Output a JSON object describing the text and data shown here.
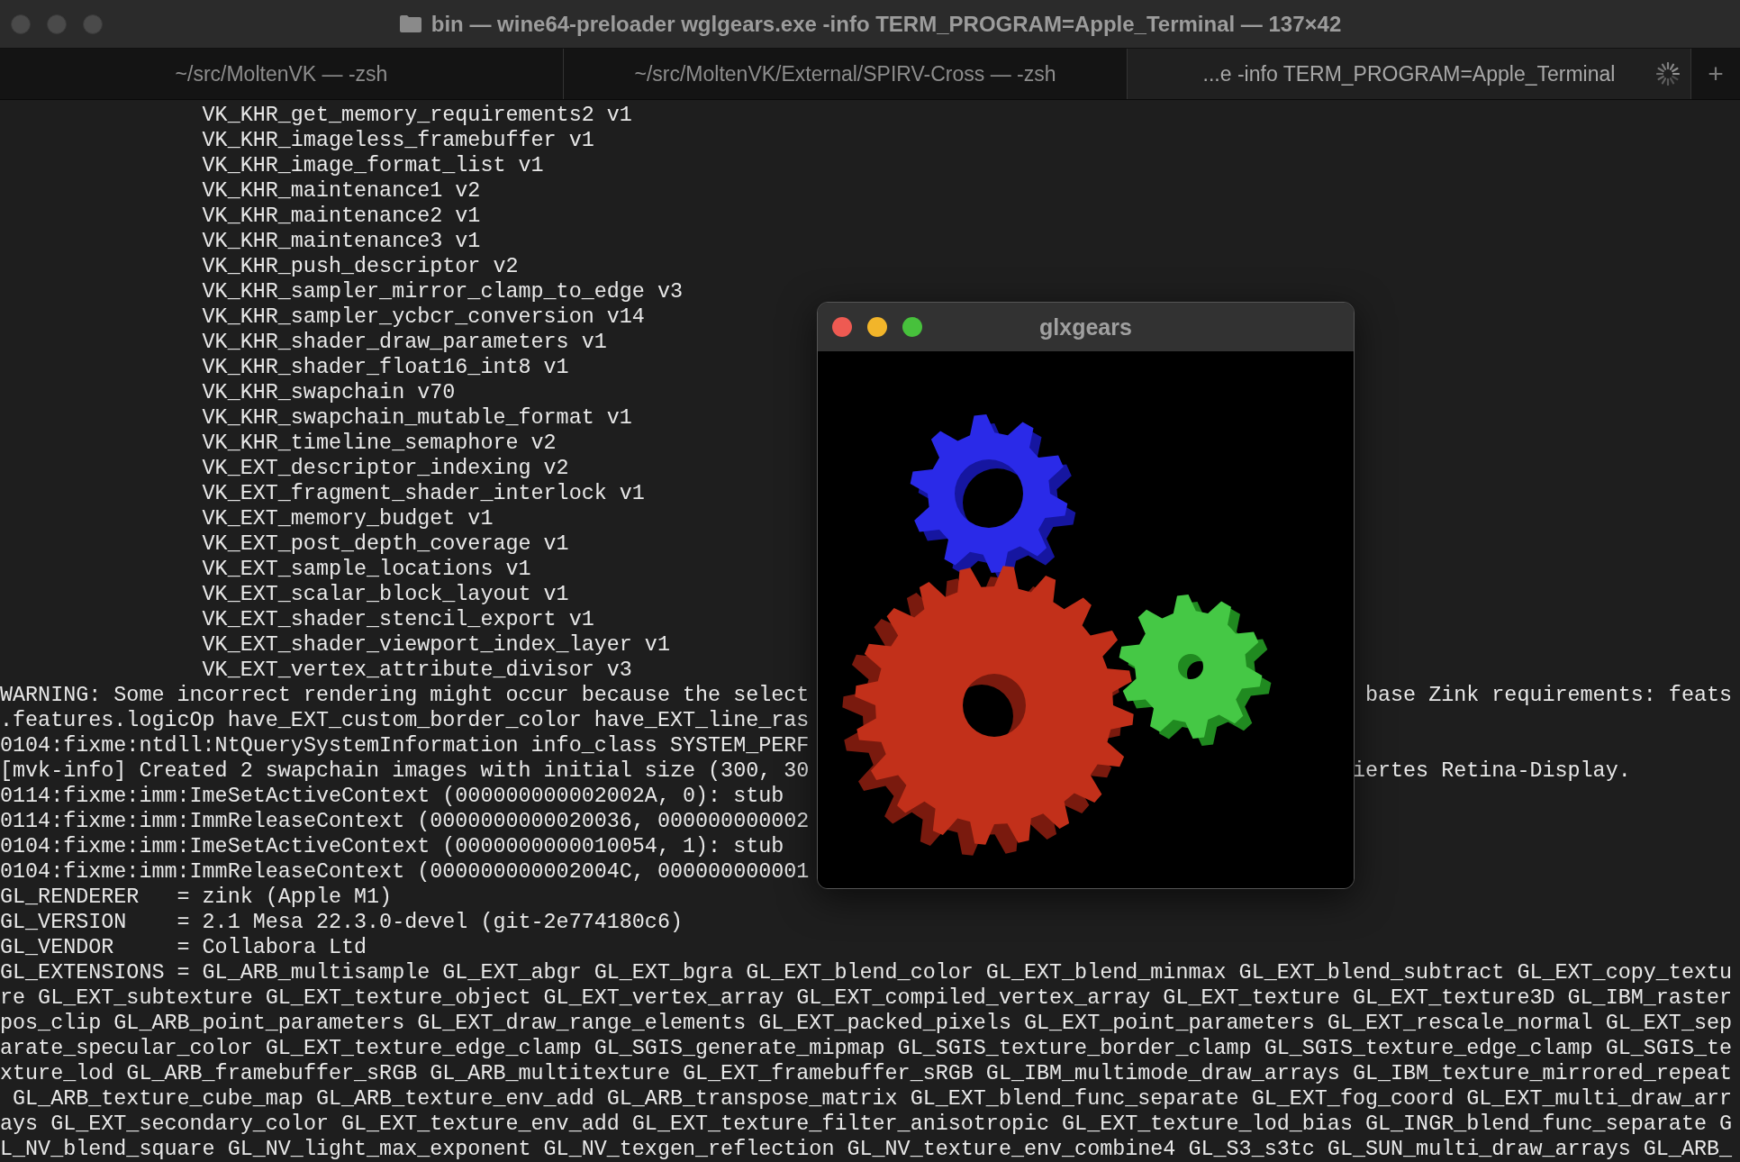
{
  "window": {
    "title": "bin — wine64-preloader wglgears.exe -info TERM_PROGRAM=Apple_Terminal — 137×42"
  },
  "tabs": [
    {
      "label": "~/src/MoltenVK — -zsh",
      "selected": false,
      "busy": false
    },
    {
      "label": "~/src/MoltenVK/External/SPIRV-Cross — -zsh",
      "selected": false,
      "busy": false
    },
    {
      "label": "...e -info TERM_PROGRAM=Apple_Terminal",
      "selected": true,
      "busy": true
    }
  ],
  "new_tab_button": "+",
  "terminal": {
    "lines": [
      {
        "kind": "indented",
        "text": "VK_KHR_get_memory_requirements2 v1"
      },
      {
        "kind": "indented",
        "text": "VK_KHR_imageless_framebuffer v1"
      },
      {
        "kind": "indented",
        "text": "VK_KHR_image_format_list v1"
      },
      {
        "kind": "indented",
        "text": "VK_KHR_maintenance1 v2"
      },
      {
        "kind": "indented",
        "text": "VK_KHR_maintenance2 v1"
      },
      {
        "kind": "indented",
        "text": "VK_KHR_maintenance3 v1"
      },
      {
        "kind": "indented",
        "text": "VK_KHR_push_descriptor v2"
      },
      {
        "kind": "indented",
        "text": "VK_KHR_sampler_mirror_clamp_to_edge v3"
      },
      {
        "kind": "indented",
        "text": "VK_KHR_sampler_ycbcr_conversion v14"
      },
      {
        "kind": "indented",
        "text": "VK_KHR_shader_draw_parameters v1"
      },
      {
        "kind": "indented",
        "text": "VK_KHR_shader_float16_int8 v1"
      },
      {
        "kind": "indented",
        "text": "VK_KHR_swapchain v70"
      },
      {
        "kind": "indented",
        "text": "VK_KHR_swapchain_mutable_format v1"
      },
      {
        "kind": "indented",
        "text": "VK_KHR_timeline_semaphore v2"
      },
      {
        "kind": "indented",
        "text": "VK_EXT_descriptor_indexing v2"
      },
      {
        "kind": "indented",
        "text": "VK_EXT_fragment_shader_interlock v1"
      },
      {
        "kind": "indented",
        "text": "VK_EXT_memory_budget v1"
      },
      {
        "kind": "indented",
        "text": "VK_EXT_post_depth_coverage v1"
      },
      {
        "kind": "indented",
        "text": "VK_EXT_sample_locations v1"
      },
      {
        "kind": "indented",
        "text": "VK_EXT_scalar_block_layout v1"
      },
      {
        "kind": "indented",
        "text": "VK_EXT_shader_stencil_export v1"
      },
      {
        "kind": "indented",
        "text": "VK_EXT_shader_viewport_index_layer v1"
      },
      {
        "kind": "indented",
        "text": "VK_EXT_vertex_attribute_divisor v3"
      },
      {
        "kind": "plain",
        "text": "WARNING: Some incorrect rendering might occur because the select",
        "right": " base Zink requirements: feats"
      },
      {
        "kind": "plain",
        "text": ".features.logicOp have_EXT_custom_border_color have_EXT_line_ras"
      },
      {
        "kind": "plain",
        "text": "0104:fixme:ntdll:NtQuerySystemInformation info_class SYSTEM_PERF"
      },
      {
        "kind": "plain",
        "text": "[mvk-info] Created 2 swapchain images with initial size (300, 30",
        "right": "iertes Retina-Display."
      },
      {
        "kind": "plain",
        "text": "0114:fixme:imm:ImeSetActiveContext (000000000002002A, 0): stub"
      },
      {
        "kind": "plain",
        "text": "0114:fixme:imm:ImmReleaseContext (0000000000020036, 000000000002"
      },
      {
        "kind": "plain",
        "text": "0104:fixme:imm:ImeSetActiveContext (0000000000010054, 1): stub"
      },
      {
        "kind": "plain",
        "text": "0104:fixme:imm:ImmReleaseContext (000000000002004C, 000000000001"
      },
      {
        "kind": "plain",
        "text": "GL_RENDERER   = zink (Apple M1)"
      },
      {
        "kind": "plain",
        "text": "GL_VERSION    = 2.1 Mesa 22.3.0-devel (git-2e774180c6)"
      },
      {
        "kind": "plain",
        "text": "GL_VENDOR     = Collabora Ltd"
      },
      {
        "kind": "plain",
        "text": "GL_EXTENSIONS = GL_ARB_multisample GL_EXT_abgr GL_EXT_bgra GL_EXT_blend_color GL_EXT_blend_minmax GL_EXT_blend_subtract GL_EXT_copy_textu"
      },
      {
        "kind": "plain",
        "text": "re GL_EXT_subtexture GL_EXT_texture_object GL_EXT_vertex_array GL_EXT_compiled_vertex_array GL_EXT_texture GL_EXT_texture3D GL_IBM_raster"
      },
      {
        "kind": "plain",
        "text": "pos_clip GL_ARB_point_parameters GL_EXT_draw_range_elements GL_EXT_packed_pixels GL_EXT_point_parameters GL_EXT_rescale_normal GL_EXT_sep"
      },
      {
        "kind": "plain",
        "text": "arate_specular_color GL_EXT_texture_edge_clamp GL_SGIS_generate_mipmap GL_SGIS_texture_border_clamp GL_SGIS_texture_edge_clamp GL_SGIS_te"
      },
      {
        "kind": "plain",
        "text": "xture_lod GL_ARB_framebuffer_sRGB GL_ARB_multitexture GL_EXT_framebuffer_sRGB GL_IBM_multimode_draw_arrays GL_IBM_texture_mirrored_repeat"
      },
      {
        "kind": "plain",
        "text": " GL_ARB_texture_cube_map GL_ARB_texture_env_add GL_ARB_transpose_matrix GL_EXT_blend_func_separate GL_EXT_fog_coord GL_EXT_multi_draw_arr"
      },
      {
        "kind": "plain",
        "text": "ays GL_EXT_secondary_color GL_EXT_texture_env_add GL_EXT_texture_filter_anisotropic GL_EXT_texture_lod_bias GL_INGR_blend_func_separate G"
      },
      {
        "kind": "plain",
        "text": "L_NV_blend_square GL_NV_light_max_exponent GL_NV_texgen_reflection GL_NV_texture_env_combine4 GL_S3_s3tc GL_SUN_multi_draw_arrays GL_ARB_"
      }
    ]
  },
  "overlay_window": {
    "title": "glxgears"
  }
}
